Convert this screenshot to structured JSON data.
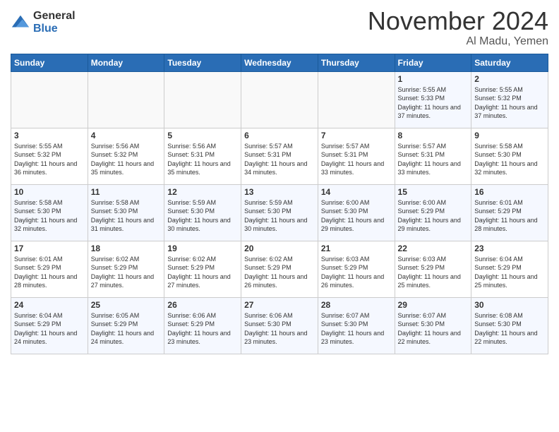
{
  "header": {
    "logo_general": "General",
    "logo_blue": "Blue",
    "month": "November 2024",
    "location": "Al Madu, Yemen"
  },
  "weekdays": [
    "Sunday",
    "Monday",
    "Tuesday",
    "Wednesday",
    "Thursday",
    "Friday",
    "Saturday"
  ],
  "weeks": [
    [
      {
        "day": "",
        "sunrise": "",
        "sunset": "",
        "daylight": ""
      },
      {
        "day": "",
        "sunrise": "",
        "sunset": "",
        "daylight": ""
      },
      {
        "day": "",
        "sunrise": "",
        "sunset": "",
        "daylight": ""
      },
      {
        "day": "",
        "sunrise": "",
        "sunset": "",
        "daylight": ""
      },
      {
        "day": "",
        "sunrise": "",
        "sunset": "",
        "daylight": ""
      },
      {
        "day": "1",
        "sunrise": "5:55 AM",
        "sunset": "5:33 PM",
        "daylight": "11 hours and 37 minutes."
      },
      {
        "day": "2",
        "sunrise": "5:55 AM",
        "sunset": "5:32 PM",
        "daylight": "11 hours and 37 minutes."
      }
    ],
    [
      {
        "day": "3",
        "sunrise": "5:55 AM",
        "sunset": "5:32 PM",
        "daylight": "11 hours and 36 minutes."
      },
      {
        "day": "4",
        "sunrise": "5:56 AM",
        "sunset": "5:32 PM",
        "daylight": "11 hours and 35 minutes."
      },
      {
        "day": "5",
        "sunrise": "5:56 AM",
        "sunset": "5:31 PM",
        "daylight": "11 hours and 35 minutes."
      },
      {
        "day": "6",
        "sunrise": "5:57 AM",
        "sunset": "5:31 PM",
        "daylight": "11 hours and 34 minutes."
      },
      {
        "day": "7",
        "sunrise": "5:57 AM",
        "sunset": "5:31 PM",
        "daylight": "11 hours and 33 minutes."
      },
      {
        "day": "8",
        "sunrise": "5:57 AM",
        "sunset": "5:31 PM",
        "daylight": "11 hours and 33 minutes."
      },
      {
        "day": "9",
        "sunrise": "5:58 AM",
        "sunset": "5:30 PM",
        "daylight": "11 hours and 32 minutes."
      }
    ],
    [
      {
        "day": "10",
        "sunrise": "5:58 AM",
        "sunset": "5:30 PM",
        "daylight": "11 hours and 32 minutes."
      },
      {
        "day": "11",
        "sunrise": "5:58 AM",
        "sunset": "5:30 PM",
        "daylight": "11 hours and 31 minutes."
      },
      {
        "day": "12",
        "sunrise": "5:59 AM",
        "sunset": "5:30 PM",
        "daylight": "11 hours and 30 minutes."
      },
      {
        "day": "13",
        "sunrise": "5:59 AM",
        "sunset": "5:30 PM",
        "daylight": "11 hours and 30 minutes."
      },
      {
        "day": "14",
        "sunrise": "6:00 AM",
        "sunset": "5:30 PM",
        "daylight": "11 hours and 29 minutes."
      },
      {
        "day": "15",
        "sunrise": "6:00 AM",
        "sunset": "5:29 PM",
        "daylight": "11 hours and 29 minutes."
      },
      {
        "day": "16",
        "sunrise": "6:01 AM",
        "sunset": "5:29 PM",
        "daylight": "11 hours and 28 minutes."
      }
    ],
    [
      {
        "day": "17",
        "sunrise": "6:01 AM",
        "sunset": "5:29 PM",
        "daylight": "11 hours and 28 minutes."
      },
      {
        "day": "18",
        "sunrise": "6:02 AM",
        "sunset": "5:29 PM",
        "daylight": "11 hours and 27 minutes."
      },
      {
        "day": "19",
        "sunrise": "6:02 AM",
        "sunset": "5:29 PM",
        "daylight": "11 hours and 27 minutes."
      },
      {
        "day": "20",
        "sunrise": "6:02 AM",
        "sunset": "5:29 PM",
        "daylight": "11 hours and 26 minutes."
      },
      {
        "day": "21",
        "sunrise": "6:03 AM",
        "sunset": "5:29 PM",
        "daylight": "11 hours and 26 minutes."
      },
      {
        "day": "22",
        "sunrise": "6:03 AM",
        "sunset": "5:29 PM",
        "daylight": "11 hours and 25 minutes."
      },
      {
        "day": "23",
        "sunrise": "6:04 AM",
        "sunset": "5:29 PM",
        "daylight": "11 hours and 25 minutes."
      }
    ],
    [
      {
        "day": "24",
        "sunrise": "6:04 AM",
        "sunset": "5:29 PM",
        "daylight": "11 hours and 24 minutes."
      },
      {
        "day": "25",
        "sunrise": "6:05 AM",
        "sunset": "5:29 PM",
        "daylight": "11 hours and 24 minutes."
      },
      {
        "day": "26",
        "sunrise": "6:06 AM",
        "sunset": "5:29 PM",
        "daylight": "11 hours and 23 minutes."
      },
      {
        "day": "27",
        "sunrise": "6:06 AM",
        "sunset": "5:30 PM",
        "daylight": "11 hours and 23 minutes."
      },
      {
        "day": "28",
        "sunrise": "6:07 AM",
        "sunset": "5:30 PM",
        "daylight": "11 hours and 23 minutes."
      },
      {
        "day": "29",
        "sunrise": "6:07 AM",
        "sunset": "5:30 PM",
        "daylight": "11 hours and 22 minutes."
      },
      {
        "day": "30",
        "sunrise": "6:08 AM",
        "sunset": "5:30 PM",
        "daylight": "11 hours and 22 minutes."
      }
    ]
  ],
  "labels": {
    "sunrise_prefix": "Sunrise: ",
    "sunset_prefix": "Sunset: ",
    "daylight_prefix": "Daylight: "
  }
}
